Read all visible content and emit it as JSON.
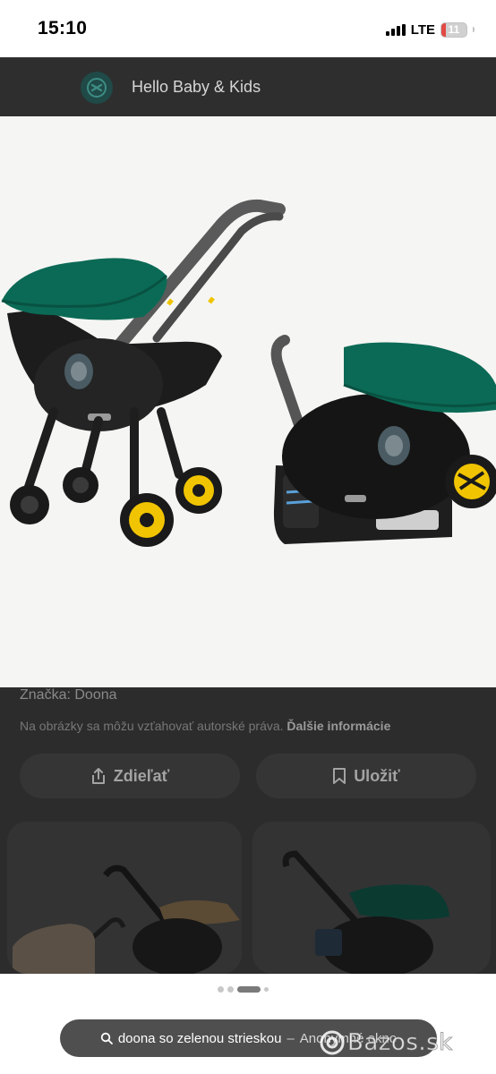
{
  "status_bar": {
    "time": "15:10",
    "network": "LTE",
    "battery_level": "11",
    "battery_fraction": 0.11,
    "battery_color": "#e24a45"
  },
  "header": {
    "site_name": "Hello Baby & Kids",
    "logo_icon": "hello-baby-logo-icon"
  },
  "product": {
    "image_icon": "doona-car-seat-stroller-photo",
    "canopy_color": "#0b6a55",
    "wheel_accent_color": "#f0c400",
    "brand_line": "Značka: Doona",
    "copyright_text": "Na obrázky sa môžu vzťahovať autorské práva.",
    "more_info_label": "Ďalšie informácie"
  },
  "actions": {
    "share_label": "Zdieľať",
    "share_icon": "share-icon",
    "save_label": "Uložiť",
    "save_icon": "bookmark-icon"
  },
  "carousel": {
    "dots": 4,
    "active_index": 2
  },
  "browser": {
    "search_icon": "search-icon",
    "url_query": "doona so zelenou strieskou",
    "separator": "–",
    "mode_label": "Anonymné okno"
  },
  "watermark": {
    "text": "Bazos.sk"
  }
}
